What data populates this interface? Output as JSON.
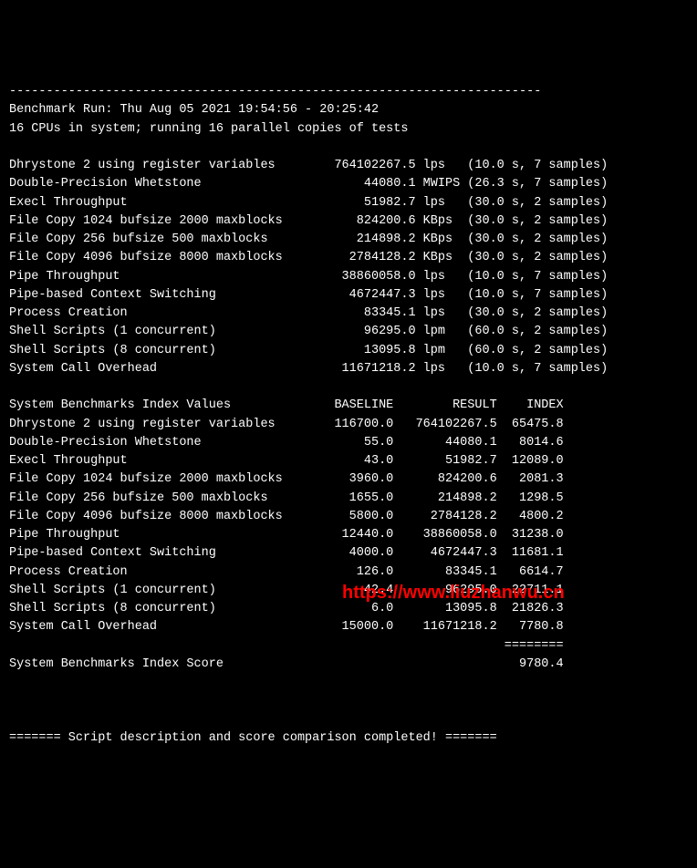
{
  "hr_top": "------------------------------------------------------------------------",
  "header_line1": "Benchmark Run: Thu Aug 05 2021 19:54:56 - 20:25:42",
  "header_line2": "16 CPUs in system; running 16 parallel copies of tests",
  "results": [
    {
      "name": "Dhrystone 2 using register variables",
      "value": "764102267.5",
      "unit": "lps",
      "time": "10.0",
      "samples": "7"
    },
    {
      "name": "Double-Precision Whetstone",
      "value": "44080.1",
      "unit": "MWIPS",
      "time": "26.3",
      "samples": "7"
    },
    {
      "name": "Execl Throughput",
      "value": "51982.7",
      "unit": "lps",
      "time": "30.0",
      "samples": "2"
    },
    {
      "name": "File Copy 1024 bufsize 2000 maxblocks",
      "value": "824200.6",
      "unit": "KBps",
      "time": "30.0",
      "samples": "2"
    },
    {
      "name": "File Copy 256 bufsize 500 maxblocks",
      "value": "214898.2",
      "unit": "KBps",
      "time": "30.0",
      "samples": "2"
    },
    {
      "name": "File Copy 4096 bufsize 8000 maxblocks",
      "value": "2784128.2",
      "unit": "KBps",
      "time": "30.0",
      "samples": "2"
    },
    {
      "name": "Pipe Throughput",
      "value": "38860058.0",
      "unit": "lps",
      "time": "10.0",
      "samples": "7"
    },
    {
      "name": "Pipe-based Context Switching",
      "value": "4672447.3",
      "unit": "lps",
      "time": "10.0",
      "samples": "7"
    },
    {
      "name": "Process Creation",
      "value": "83345.1",
      "unit": "lps",
      "time": "30.0",
      "samples": "2"
    },
    {
      "name": "Shell Scripts (1 concurrent)",
      "value": "96295.0",
      "unit": "lpm",
      "time": "60.0",
      "samples": "2"
    },
    {
      "name": "Shell Scripts (8 concurrent)",
      "value": "13095.8",
      "unit": "lpm",
      "time": "60.0",
      "samples": "2"
    },
    {
      "name": "System Call Overhead",
      "value": "11671218.2",
      "unit": "lps",
      "time": "10.0",
      "samples": "7"
    }
  ],
  "index_header": {
    "c1": "System Benchmarks Index Values",
    "c2": "BASELINE",
    "c3": "RESULT",
    "c4": "INDEX"
  },
  "index": [
    {
      "name": "Dhrystone 2 using register variables",
      "baseline": "116700.0",
      "result": "764102267.5",
      "idx": "65475.8"
    },
    {
      "name": "Double-Precision Whetstone",
      "baseline": "55.0",
      "result": "44080.1",
      "idx": "8014.6"
    },
    {
      "name": "Execl Throughput",
      "baseline": "43.0",
      "result": "51982.7",
      "idx": "12089.0"
    },
    {
      "name": "File Copy 1024 bufsize 2000 maxblocks",
      "baseline": "3960.0",
      "result": "824200.6",
      "idx": "2081.3"
    },
    {
      "name": "File Copy 256 bufsize 500 maxblocks",
      "baseline": "1655.0",
      "result": "214898.2",
      "idx": "1298.5"
    },
    {
      "name": "File Copy 4096 bufsize 8000 maxblocks",
      "baseline": "5800.0",
      "result": "2784128.2",
      "idx": "4800.2"
    },
    {
      "name": "Pipe Throughput",
      "baseline": "12440.0",
      "result": "38860058.0",
      "idx": "31238.0"
    },
    {
      "name": "Pipe-based Context Switching",
      "baseline": "4000.0",
      "result": "4672447.3",
      "idx": "11681.1"
    },
    {
      "name": "Process Creation",
      "baseline": "126.0",
      "result": "83345.1",
      "idx": "6614.7"
    },
    {
      "name": "Shell Scripts (1 concurrent)",
      "baseline": "42.4",
      "result": "96295.0",
      "idx": "22711.1"
    },
    {
      "name": "Shell Scripts (8 concurrent)",
      "baseline": "6.0",
      "result": "13095.8",
      "idx": "21826.3"
    },
    {
      "name": "System Call Overhead",
      "baseline": "15000.0",
      "result": "11671218.2",
      "idx": "7780.8"
    }
  ],
  "score_sep": "                                                                   ========",
  "score_label": "System Benchmarks Index Score",
  "score_value": "9780.4",
  "footer": "======= Script description and score comparison completed! =======",
  "watermark": "https://www.liuzhanwu.cn"
}
